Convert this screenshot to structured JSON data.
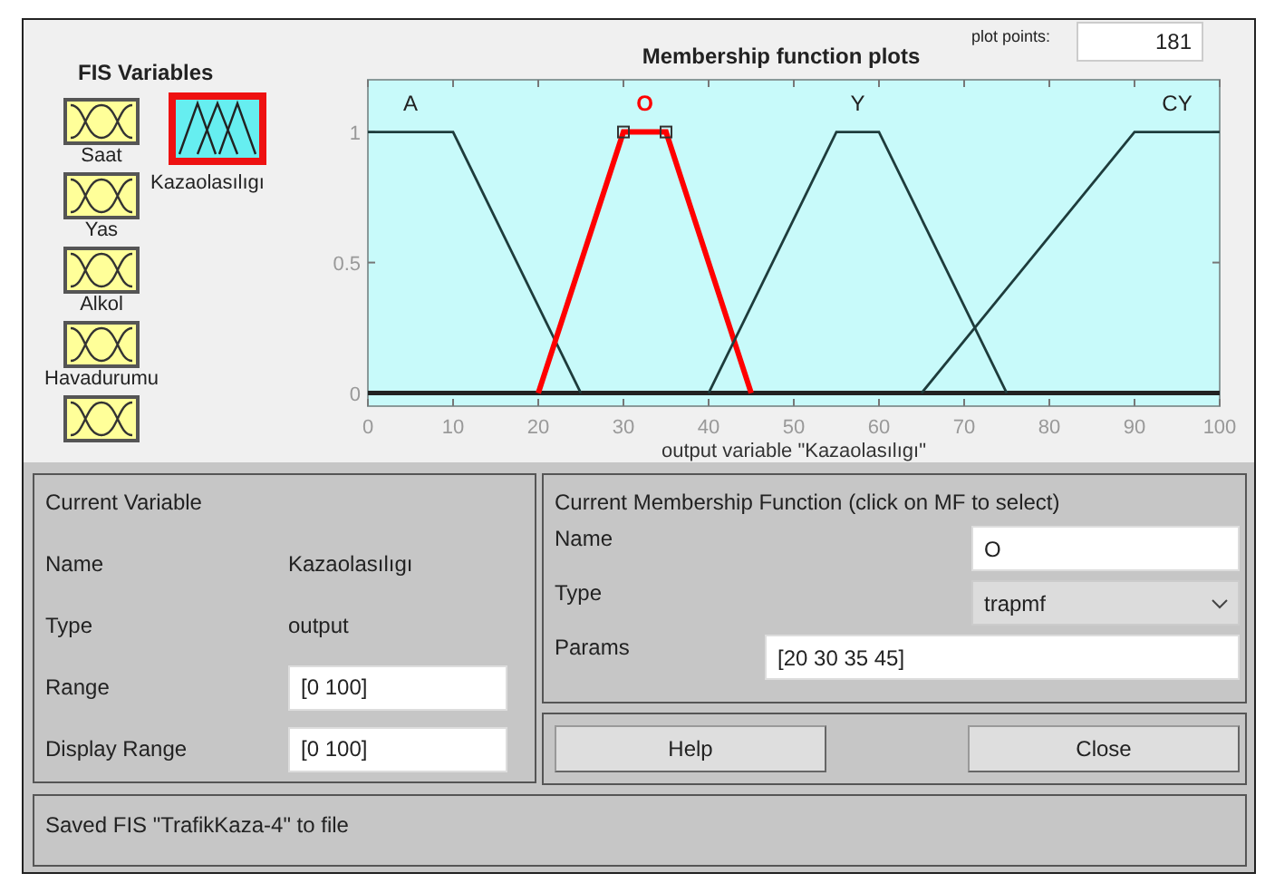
{
  "fis_variables": {
    "title": "FIS Variables",
    "items": [
      {
        "name": "Saat",
        "kind": "input",
        "selected": false
      },
      {
        "name": "Yas",
        "kind": "input",
        "selected": false
      },
      {
        "name": "Alkol",
        "kind": "input",
        "selected": false
      },
      {
        "name": "Havadurumu",
        "kind": "input",
        "selected": false
      },
      {
        "kind": "input",
        "selected": false
      },
      {
        "name": "Kazaolasılıgı",
        "kind": "output",
        "selected": true
      }
    ]
  },
  "plot": {
    "title": "Membership function plots",
    "plot_points_label": "plot points:",
    "plot_points": "181",
    "chart_data": {
      "type": "line",
      "xlabel": "output variable \"Kazaolasılıgı\"",
      "x": [
        0,
        10,
        20,
        25,
        30,
        35,
        40,
        45,
        55,
        60,
        65,
        75,
        90,
        100
      ],
      "series": [
        {
          "name": "A",
          "color": "#1e3c3c",
          "values": [
            1,
            1,
            0.333,
            0,
            null,
            null,
            null,
            null,
            null,
            null,
            null,
            null,
            null,
            null
          ]
        },
        {
          "name": "O",
          "color": "#ff0000",
          "values": [
            null,
            null,
            0,
            0.5,
            1,
            1,
            0.5,
            0,
            null,
            null,
            null,
            null,
            null,
            null
          ]
        },
        {
          "name": "Y",
          "color": "#1e3c3c",
          "values": [
            null,
            null,
            null,
            null,
            null,
            null,
            0,
            0.333,
            1,
            1,
            0.667,
            0,
            null,
            null
          ]
        },
        {
          "name": "CY",
          "color": "#1e3c3c",
          "values": [
            null,
            null,
            null,
            null,
            null,
            null,
            null,
            null,
            null,
            null,
            0,
            0.4,
            1,
            1
          ]
        }
      ],
      "xlim": [
        0,
        100
      ],
      "ylim": [
        -0.05,
        1.2
      ],
      "xticks": [
        0,
        10,
        20,
        30,
        40,
        50,
        60,
        70,
        80,
        90,
        100
      ],
      "yticks": [
        0,
        0.5,
        1
      ]
    }
  },
  "current_variable": {
    "title": "Current Variable",
    "rows": [
      {
        "label": "Name",
        "kind": "text",
        "value": "Kazaolasılıgı"
      },
      {
        "label": "Type",
        "kind": "text",
        "value": "output"
      },
      {
        "label": "Range",
        "kind": "field",
        "value": "[0 100]"
      },
      {
        "label": "Display Range",
        "kind": "field",
        "value": "[0 100]"
      }
    ]
  },
  "current_mf": {
    "title": "Current Membership Function (click on MF to select)",
    "rows": [
      {
        "label": "Name",
        "kind": "field",
        "value": "O"
      },
      {
        "label": "Type",
        "kind": "dropdown",
        "value": "trapmf"
      },
      {
        "label": "Params",
        "kind": "wide_field",
        "value": "[20 30 35 45]"
      }
    ]
  },
  "buttons": [
    "Help",
    "Close"
  ],
  "status_bar": "Saved FIS \"TrafikKaza-4\" to file"
}
